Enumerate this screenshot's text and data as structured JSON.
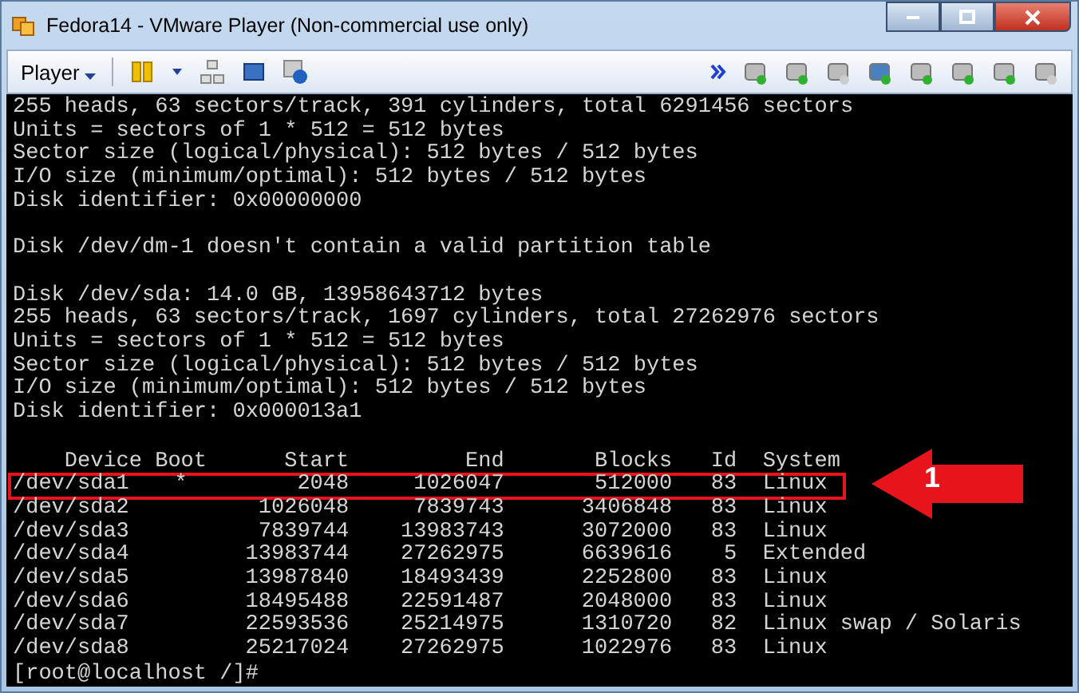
{
  "window": {
    "title": "Fedora14 - VMware Player (Non-commercial use only)"
  },
  "toolbar": {
    "menu": "Player"
  },
  "terminal": {
    "blocks": [
      [
        "255 heads, 63 sectors/track, 391 cylinders, total 6291456 sectors",
        "Units = sectors of 1 * 512 = 512 bytes",
        "Sector size (logical/physical): 512 bytes / 512 bytes",
        "I/O size (minimum/optimal): 512 bytes / 512 bytes",
        "Disk identifier: 0x00000000"
      ],
      [
        "Disk /dev/dm-1 doesn't contain a valid partition table"
      ],
      [
        "Disk /dev/sda: 14.0 GB, 13958643712 bytes",
        "255 heads, 63 sectors/track, 1697 cylinders, total 27262976 sectors",
        "Units = sectors of 1 * 512 = 512 bytes",
        "Sector size (logical/physical): 512 bytes / 512 bytes",
        "I/O size (minimum/optimal): 512 bytes / 512 bytes",
        "Disk identifier: 0x000013a1"
      ]
    ],
    "table": {
      "columns": [
        "Device",
        "Boot",
        "Start",
        "End",
        "Blocks",
        "Id",
        "System"
      ],
      "rows": [
        {
          "cells": [
            "/dev/sda1",
            "*",
            "2048",
            "1026047",
            "512000",
            "83",
            "Linux"
          ],
          "highlighted": true
        },
        {
          "cells": [
            "/dev/sda2",
            "",
            "1026048",
            "7839743",
            "3406848",
            "83",
            "Linux"
          ],
          "highlighted": false
        },
        {
          "cells": [
            "/dev/sda3",
            "",
            "7839744",
            "13983743",
            "3072000",
            "83",
            "Linux"
          ],
          "highlighted": false
        },
        {
          "cells": [
            "/dev/sda4",
            "",
            "13983744",
            "27262975",
            "6639616",
            "5",
            "Extended"
          ],
          "highlighted": false
        },
        {
          "cells": [
            "/dev/sda5",
            "",
            "13987840",
            "18493439",
            "2252800",
            "83",
            "Linux"
          ],
          "highlighted": false
        },
        {
          "cells": [
            "/dev/sda6",
            "",
            "18495488",
            "22591487",
            "2048000",
            "83",
            "Linux"
          ],
          "highlighted": false
        },
        {
          "cells": [
            "/dev/sda7",
            "",
            "22593536",
            "25214975",
            "1310720",
            "82",
            "Linux swap / Solaris"
          ],
          "highlighted": false
        },
        {
          "cells": [
            "/dev/sda8",
            "",
            "25217024",
            "27262975",
            "1022976",
            "83",
            "Linux"
          ],
          "highlighted": false
        }
      ]
    },
    "prompt": "[root@localhost /]#"
  },
  "callout": {
    "label": "1"
  }
}
